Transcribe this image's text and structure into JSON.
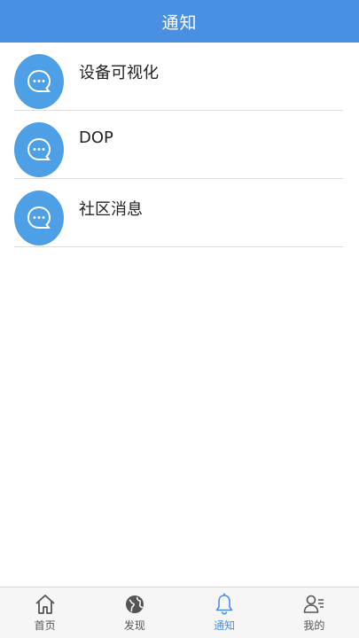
{
  "header": {
    "title": "通知"
  },
  "notifications": [
    {
      "label": "设备可视化",
      "icon": "chat-bubble-icon"
    },
    {
      "label": "DOP",
      "icon": "chat-bubble-icon"
    },
    {
      "label": "社区消息",
      "icon": "chat-bubble-icon"
    }
  ],
  "tabbar": {
    "items": [
      {
        "label": "首页",
        "icon": "home-icon",
        "active": false
      },
      {
        "label": "发现",
        "icon": "globe-icon",
        "active": false
      },
      {
        "label": "通知",
        "icon": "bell-icon",
        "active": true
      },
      {
        "label": "我的",
        "icon": "profile-icon",
        "active": false
      }
    ]
  },
  "colors": {
    "header": "#4a90e2",
    "avatar": "#4d9fe6",
    "active_tab": "#4a90e2"
  }
}
